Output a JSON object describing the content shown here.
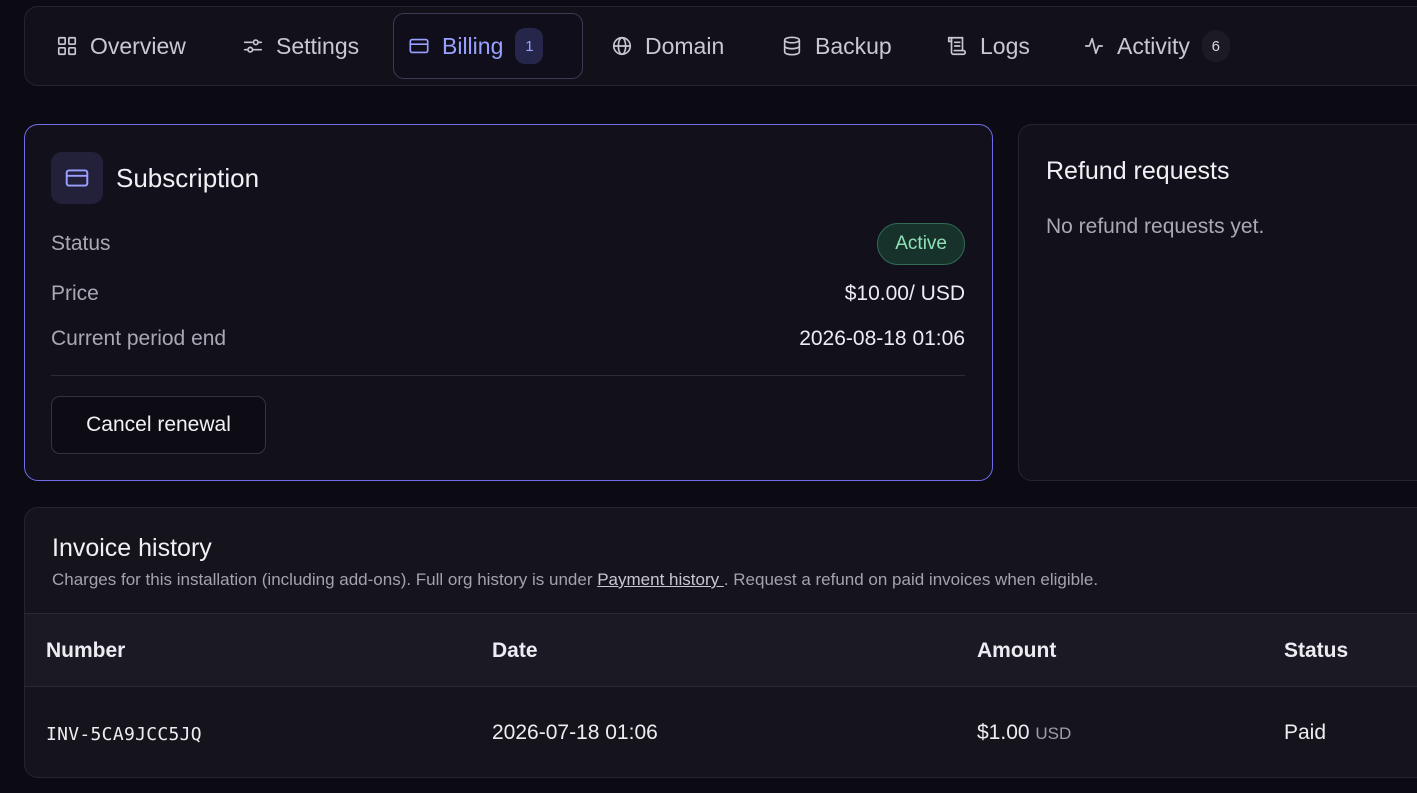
{
  "tabs": [
    {
      "label": "Overview",
      "icon": "grid-icon"
    },
    {
      "label": "Settings",
      "icon": "sliders-icon"
    },
    {
      "label": "Billing",
      "icon": "credit-card-icon",
      "badge": "1",
      "active": true
    },
    {
      "label": "Domain",
      "icon": "globe-icon"
    },
    {
      "label": "Backup",
      "icon": "database-icon"
    },
    {
      "label": "Logs",
      "icon": "scroll-icon"
    },
    {
      "label": "Activity",
      "icon": "pulse-icon",
      "badge": "6"
    }
  ],
  "subscription": {
    "title": "Subscription",
    "icon": "credit-card-icon",
    "status_label": "Status",
    "status_value": "Active",
    "price_label": "Price",
    "price_value": "$10.00/ USD",
    "period_label": "Current period end",
    "period_value": "2026-08-18 01:06",
    "cancel_button": "Cancel renewal"
  },
  "refunds": {
    "title": "Refund requests",
    "empty_text": "No refund requests yet."
  },
  "invoices": {
    "title": "Invoice history",
    "desc_before": "Charges for this installation (including add-ons). Full org history is under ",
    "desc_link": "Payment history ",
    "desc_after": ". Request a refund on paid invoices when eligible.",
    "columns": [
      "Number",
      "Date",
      "Amount",
      "Status"
    ],
    "rows": [
      {
        "number": "INV-5CA9JCC5JQ",
        "date": "2026-07-18 01:06",
        "amount": "$1.00",
        "currency": "USD",
        "status": "Paid"
      }
    ]
  },
  "colors": {
    "background": "#0c0b14",
    "accent": "#9aa0ff",
    "active_border": "#6f6ee6",
    "success": "#8fe0b9"
  }
}
